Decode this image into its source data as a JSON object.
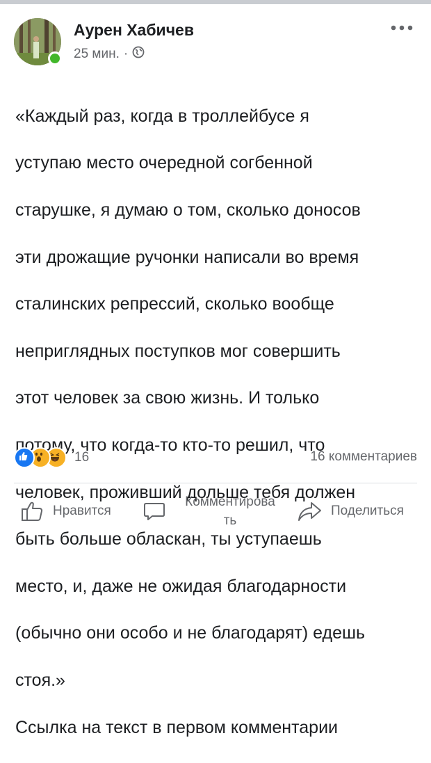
{
  "post": {
    "author": "Аурен Хабичев",
    "time": "25 мин.",
    "separator": "·",
    "text_lines": [
      "«Каждый раз, когда в троллейбусе я",
      "уступаю место очередной согбенной",
      "старушке, я думаю о том, сколько доносов",
      "эти дрожащие ручонки написали во время",
      "сталинских репрессий, сколько вообще",
      "неприглядных поступков мог совершить",
      "этот человек за свою жизнь. И только",
      "потому, что когда-то кто-то решил, что",
      "человек, проживший дольше тебя должен",
      "быть больше обласкан, ты уступаешь",
      "место, и, даже не ожидая благодарности",
      "(обычно они особо и не благодарят) едешь",
      "стоя.»",
      "Ссылка на текст в первом комментарии"
    ],
    "reactions": {
      "count": "16",
      "types": [
        "like",
        "wow",
        "haha"
      ]
    },
    "comments_count": "16 комментариев"
  },
  "actions": {
    "like": "Нравится",
    "comment_line1": "Комментирова",
    "comment_line2": "ть",
    "share": "Поделиться"
  },
  "colors": {
    "text": "#1c1e21",
    "secondary": "#65676b",
    "like_blue": "#1877f2",
    "reaction_yellow": "#f7b125",
    "online_green": "#42b72a",
    "divider": "#dadde1"
  },
  "icons": [
    "avatar",
    "globe-icon",
    "more-options-icon",
    "like-reaction-icon",
    "wow-reaction-icon",
    "haha-reaction-icon",
    "thumbs-up-icon",
    "comment-bubble-icon",
    "share-arrow-icon"
  ]
}
